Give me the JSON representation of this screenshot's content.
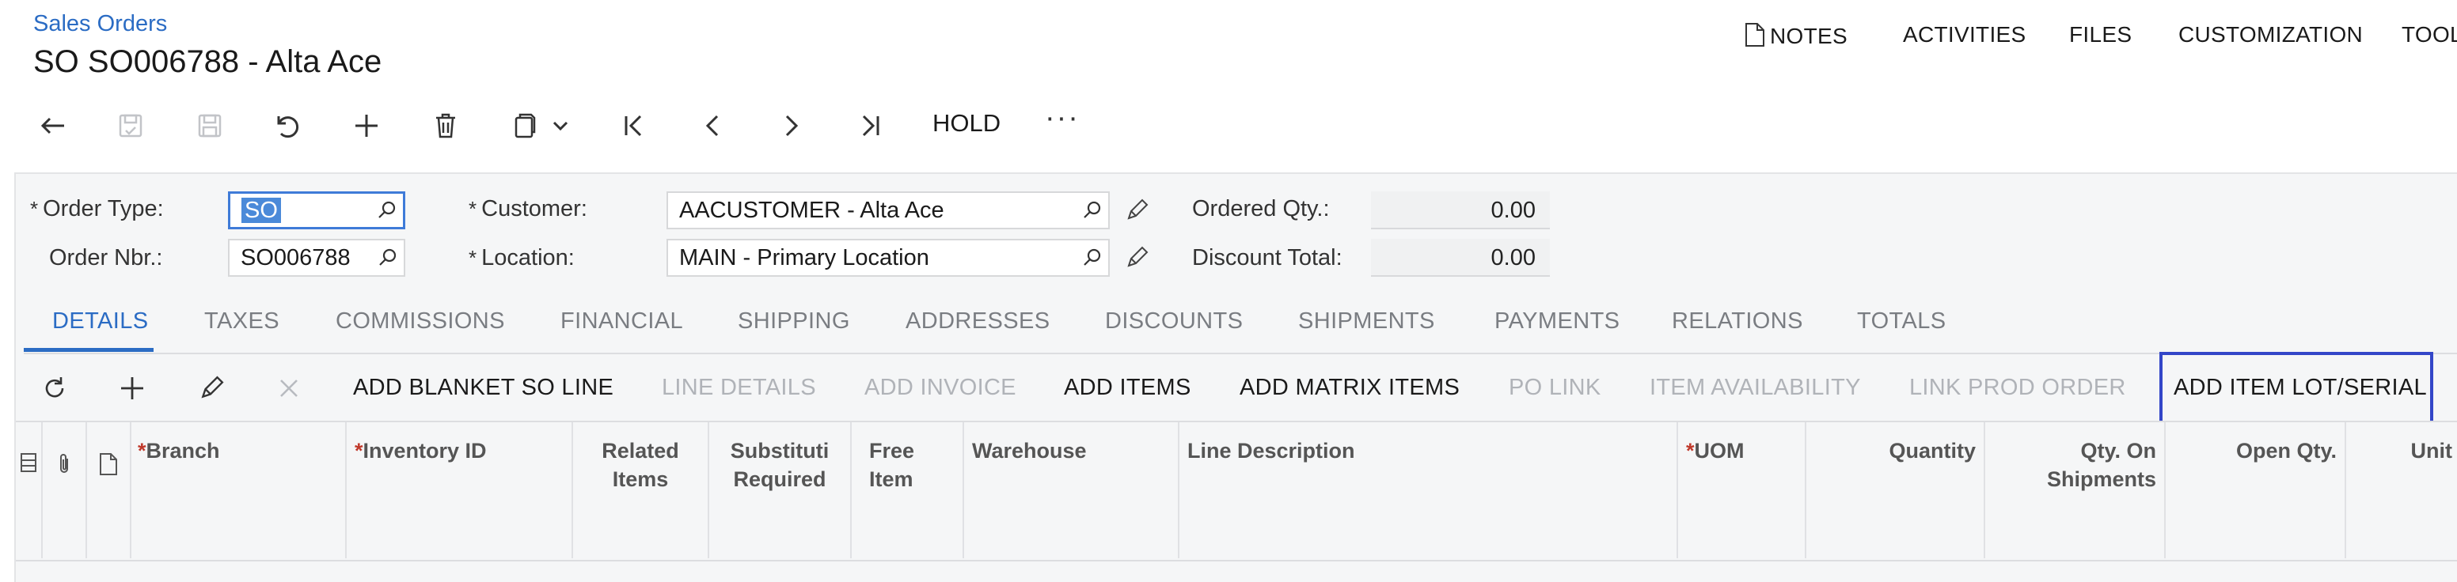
{
  "header": {
    "breadcrumb": "Sales Orders",
    "title": "SO SO006788 - Alta Ace"
  },
  "topnav": {
    "notes": "NOTES",
    "activities": "ACTIVITIES",
    "files": "FILES",
    "customization": "CUSTOMIZATION",
    "tools": "TOOLS"
  },
  "toolbar": {
    "hold": "HOLD",
    "more": "···"
  },
  "form": {
    "order_type_label": "Order Type:",
    "order_type_value": "SO",
    "order_nbr_label": "Order Nbr.:",
    "order_nbr_value": "SO006788",
    "customer_label": "Customer:",
    "customer_value": "AACUSTOMER - Alta Ace",
    "location_label": "Location:",
    "location_value": "MAIN - Primary Location",
    "ordered_qty_label": "Ordered Qty.:",
    "ordered_qty_value": "0.00",
    "discount_total_label": "Discount Total:",
    "discount_total_value": "0.00",
    "required_mark": "*"
  },
  "tabs": [
    "DETAILS",
    "TAXES",
    "COMMISSIONS",
    "FINANCIAL",
    "SHIPPING",
    "ADDRESSES",
    "DISCOUNTS",
    "SHIPMENTS",
    "PAYMENTS",
    "RELATIONS",
    "TOTALS"
  ],
  "grid_toolbar": {
    "add_blanket": "ADD BLANKET SO LINE",
    "line_details": "LINE DETAILS",
    "add_invoice": "ADD INVOICE",
    "add_items": "ADD ITEMS",
    "add_matrix": "ADD MATRIX ITEMS",
    "po_link": "PO LINK",
    "item_availability": "ITEM AVAILABILITY",
    "link_prod_order": "LINK PROD ORDER",
    "add_lot_serial": "ADD ITEM LOT/SERIAL"
  },
  "grid_columns": {
    "branch": "Branch",
    "inventory_id": "Inventory ID",
    "related_items_1": "Related",
    "related_items_2": "Items",
    "substitution_1": "Substituti",
    "substitution_2": "Required",
    "free_item_1": "Free",
    "free_item_2": "Item",
    "warehouse": "Warehouse",
    "line_description": "Line Description",
    "uom": "UOM",
    "quantity": "Quantity",
    "qty_on_shipments_1": "Qty. On",
    "qty_on_shipments_2": "Shipments",
    "open_qty": "Open Qty.",
    "unit": "Unit"
  },
  "colors": {
    "accent": "#2b6cc4",
    "highlight_border": "#3346c8",
    "required_star": "#c0392b"
  }
}
